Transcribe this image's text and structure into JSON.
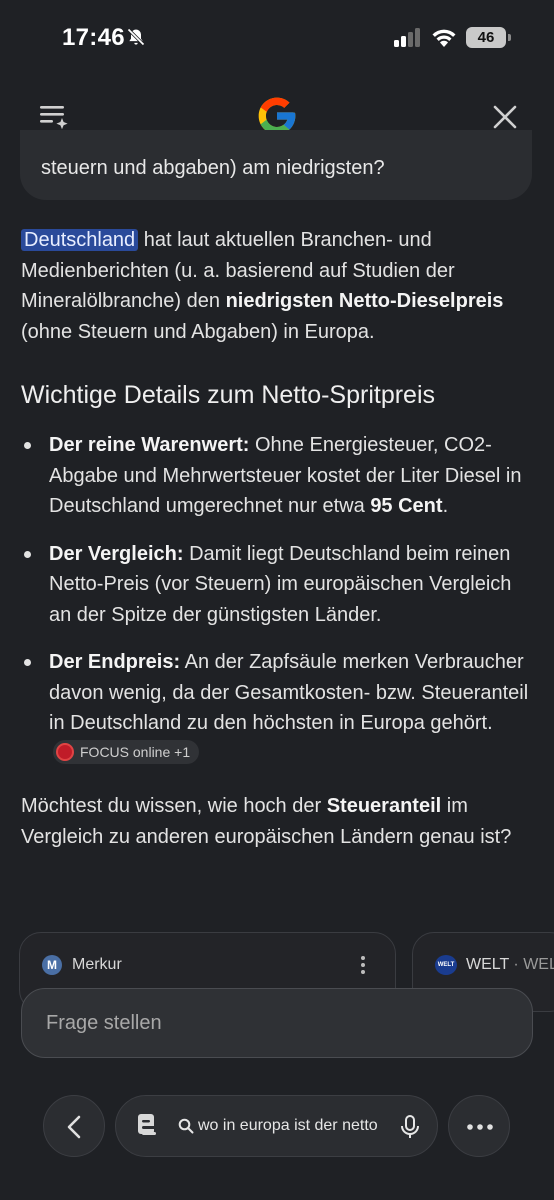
{
  "status_bar": {
    "time": "17:46",
    "battery": "46"
  },
  "previous_query": {
    "visible_text": "steuern und abgaben) am niedrigsten?"
  },
  "answer": {
    "highlight": "Deutschland",
    "p1": " hat laut aktuellen Branchen- und Medienberichten (u. a. basierend auf Studien der Mineralölbranche) den ",
    "p1_bold": "niedrigsten Netto-Dieselpreis",
    "p1_end": " (ohne Steuern und Abgaben) in Europa."
  },
  "section_heading": "Wichtige Details zum Netto-Spritpreis",
  "bullets": [
    {
      "label": "Der reine Warenwert:",
      "text": " Ohne Energiesteuer, CO2-Abgabe und Mehrwertsteuer kostet der Liter Diesel in Deutschland umgerechnet nur etwa ",
      "bold_end": "95 Cent",
      "end": "."
    },
    {
      "label": "Der Vergleich:",
      "text": " Damit liegt Deutschland beim reinen Netto-Preis (vor Steuern) im europäischen Vergleich an der Spitze der günstigsten Länder."
    },
    {
      "label": "Der Endpreis:",
      "text": " An der Zapfsäule merken Verbraucher davon wenig, da der Gesamtkosten- bzw. Steueranteil in Deutschland zu den höchsten in Europa gehört.",
      "source_chip": "FOCUS online +1"
    }
  ],
  "followup": {
    "start": "Möchtest du wissen, wie hoch der ",
    "bold": "Steueranteil",
    "end": " im Vergleich zu anderen europäischen Ländern genau ist?"
  },
  "sources": [
    {
      "logo_letter": "M",
      "name": "Merkur"
    },
    {
      "logo_text": "WELT",
      "name": "WELT",
      "separator": "·",
      "extra": "WEL"
    }
  ],
  "ask": {
    "placeholder": "Frage stellen"
  },
  "bottom_nav": {
    "search_text": "wo in europa ist der netto"
  },
  "colors": {
    "background": "#1f2125",
    "highlight": "#2a4a9a",
    "surface": "#2b2d31"
  }
}
